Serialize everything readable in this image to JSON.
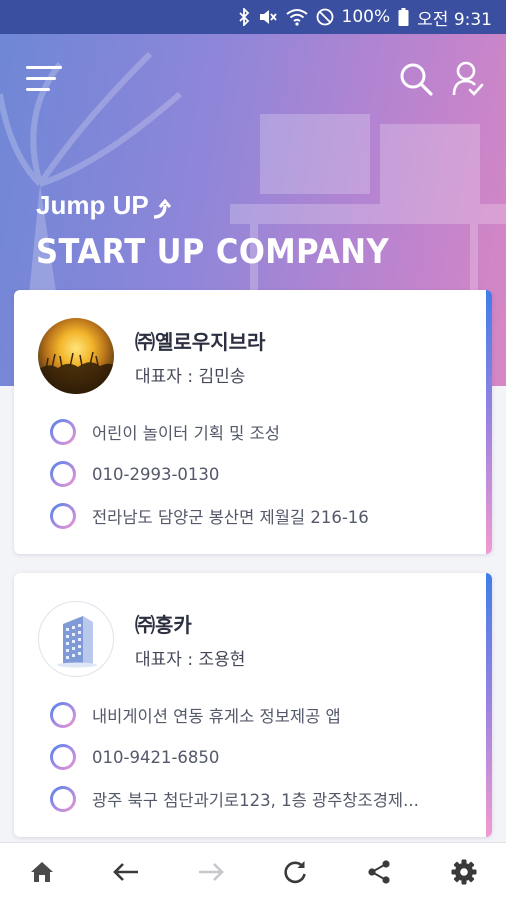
{
  "status_bar": {
    "battery": "100%",
    "time": "오전 9:31",
    "icons": [
      "bluetooth-icon",
      "mute-icon",
      "wifi-icon",
      "do-not-disturb-icon",
      "battery-icon"
    ]
  },
  "header": {
    "logo_text": "Jump UP",
    "title": "START UP COMPANY",
    "icons": [
      "menu-icon",
      "search-icon",
      "user-check-icon"
    ]
  },
  "companies": [
    {
      "name": "㈜옐로우지브라",
      "ceo": "대표자 : 김민송",
      "business": "어린이 놀이터 기획 및 조성",
      "phone": "010-2993-0130",
      "address": "전라남도 담양군 봉산면 제월길 216-16",
      "avatar": "sunset-logo"
    },
    {
      "name": "㈜홍카",
      "ceo": "대표자 : 조용현",
      "business": "내비게이션 연동 휴게소 정보제공 앱",
      "phone": "010-9421-6850",
      "address": "광주 북구 첨단과기로123, 1층 광주창조경제...",
      "avatar": "building-logo"
    }
  ],
  "bottom_nav": [
    "home-icon",
    "back-arrow-icon",
    "forward-arrow-icon",
    "refresh-icon",
    "share-icon",
    "settings-icon"
  ],
  "colors": {
    "status_bar": "#3a4f9f",
    "hero_start": "#6f87d6",
    "hero_end": "#d786c4",
    "accent_blue": "#3f7ee8",
    "accent_pink": "#f29ad0"
  }
}
